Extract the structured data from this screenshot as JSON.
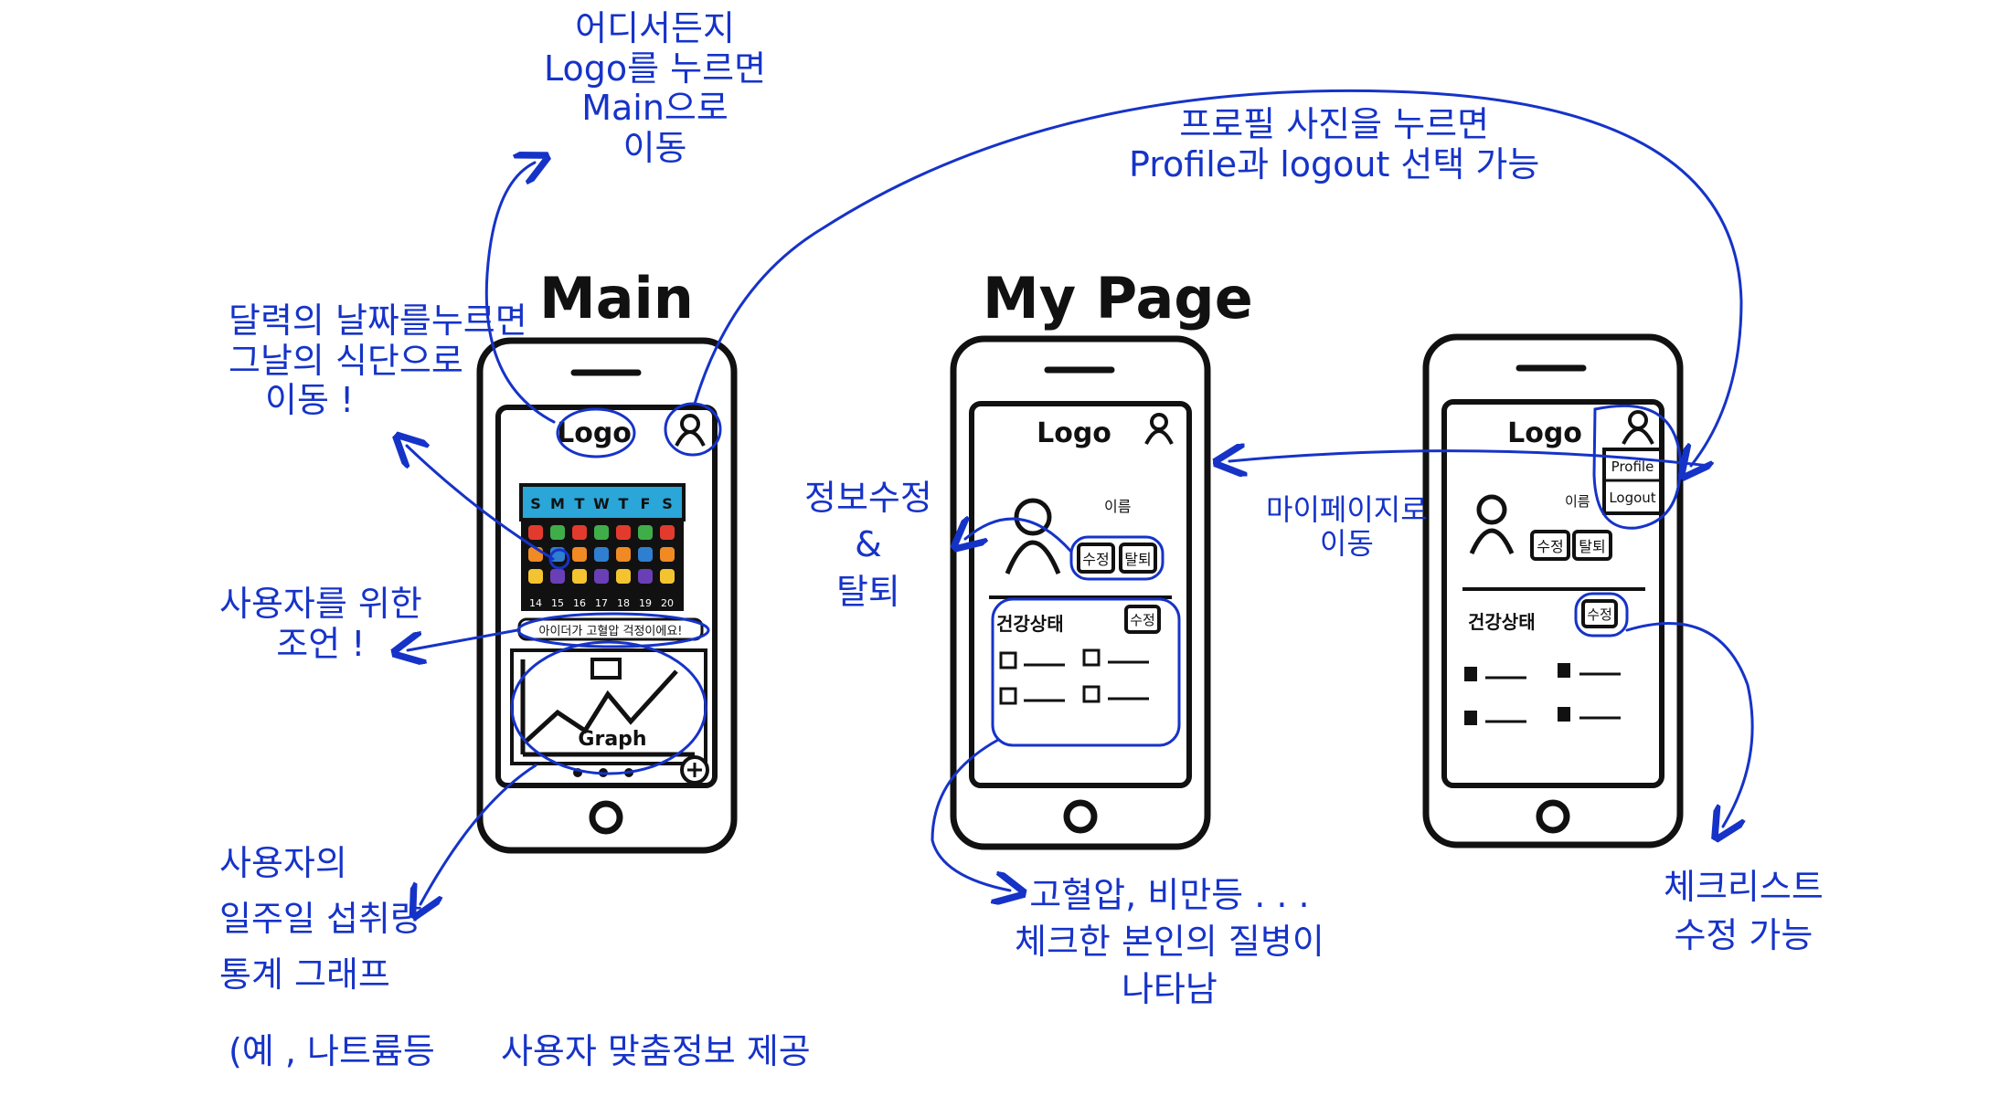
{
  "screens": {
    "main": {
      "title": "Main",
      "logo": "Logo",
      "calendar_header": [
        "S",
        "M",
        "T",
        "W",
        "T",
        "F",
        "S"
      ],
      "calendar_footer": [
        "14",
        "15",
        "16",
        "17",
        "18",
        "19",
        "20"
      ],
      "advice_text": "아이더가 고혈압 걱정이에요!",
      "graph_label": "Graph"
    },
    "mypage": {
      "title": "My Page",
      "logo": "Logo",
      "name_label": "이름",
      "edit_button": "수정",
      "withdraw_button": "탈퇴",
      "health_label": "건강상태",
      "health_edit_button": "수정"
    },
    "mypage2": {
      "logo": "Logo",
      "menu_profile": "Profile",
      "menu_logout": "Logout",
      "name_label": "이름",
      "edit_button": "수정",
      "withdraw_button": "탈퇴",
      "health_label": "건강상태",
      "health_edit_button": "수정"
    }
  },
  "annotations": {
    "logo_note": [
      "어디서든지",
      "Logo를 누르면",
      "Main으로",
      "이동"
    ],
    "profile_note": [
      "프로필 사진을 누르면",
      "Profile과 logout 선택 가능"
    ],
    "calendar_note": [
      "달력의 날짜를누르면",
      "그날의 식단으로",
      "이동 !"
    ],
    "advice_note": [
      "사용자를 위한",
      "조언 !"
    ],
    "graph_note": [
      "사용자의",
      "일주일 섭취량",
      "통계 그래프",
      "(예 , 나트륨등",
      "사용자 맞춤정보 제공"
    ],
    "edit_note": [
      "정보수정",
      "&",
      "탈퇴"
    ],
    "mypage_move_note": [
      "마이페이지로",
      "이동"
    ],
    "disease_note": [
      "고혈압, 비만등 . . .",
      "체크한 본인의 질병이",
      "나타남"
    ],
    "checklist_note": [
      "체크리스트",
      "수정 가능"
    ]
  },
  "colors": {
    "annotation_ink": "#1633c8",
    "sketch_ink": "#111111",
    "calendar_header": "#2aa6d8",
    "calendar_cells": [
      "#e23b2e",
      "#f08a24",
      "#f4c430",
      "#3fae49",
      "#2f7fd0",
      "#6a3fb5"
    ]
  }
}
